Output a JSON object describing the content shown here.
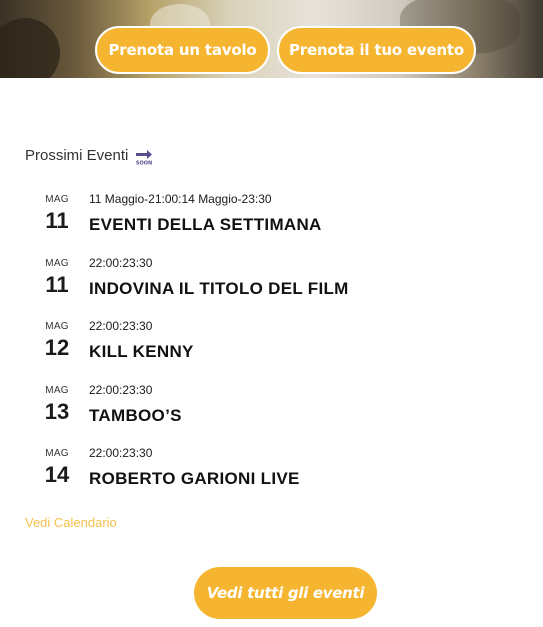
{
  "hero": {
    "book_table_label": "Prenota un tavolo",
    "book_event_label": "Prenota il tuo evento"
  },
  "upcoming": {
    "title": "Prossimi Eventi",
    "icon": "soon-arrow-icon",
    "events": [
      {
        "month": "MAG",
        "day": "11",
        "time": "11 Maggio-21:00:14 Maggio-23:30",
        "title": "EVENTI DELLA SETTIMANA"
      },
      {
        "month": "MAG",
        "day": "11",
        "time": "22:00:23:30",
        "title": "INDOVINA IL TITOLO DEL FILM"
      },
      {
        "month": "MAG",
        "day": "12",
        "time": "22:00:23:30",
        "title": "KILL KENNY"
      },
      {
        "month": "MAG",
        "day": "13",
        "time": "22:00:23:30",
        "title": "TAMBOO’S"
      },
      {
        "month": "MAG",
        "day": "14",
        "time": "22:00:23:30",
        "title": "ROBERTO GARIONI LIVE"
      }
    ],
    "calendar_link": "Vedi Calendario"
  },
  "footer": {
    "all_events_label": "Vedi tutti gli eventi"
  },
  "colors": {
    "accent": "#f6b530",
    "link": "#f6c04a",
    "icon": "#5a4d8c"
  }
}
